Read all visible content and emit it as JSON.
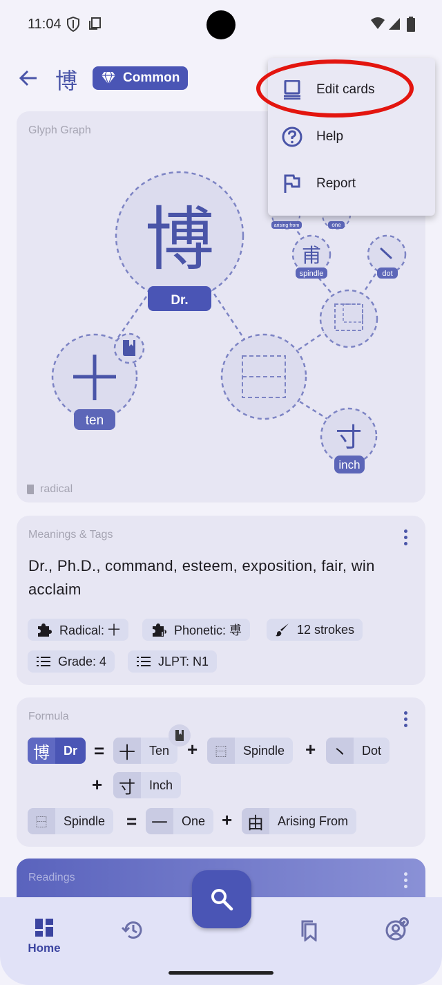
{
  "status_bar": {
    "time": "11:04"
  },
  "app_bar": {
    "title": "博",
    "badge_label": "Common"
  },
  "glyph_graph": {
    "title": "Glyph Graph",
    "main_kanji": "博",
    "main_label": "Dr.",
    "nodes": {
      "ten": {
        "glyph": "十",
        "label": "ten"
      },
      "inch": {
        "glyph": "寸",
        "label": "inch"
      },
      "spindle": {
        "glyph": "甫",
        "label": "spindle"
      },
      "dot": {
        "glyph": "丶",
        "label": "dot"
      },
      "arising_from": {
        "label": "arising from"
      },
      "one": {
        "label": "one"
      }
    },
    "legend_label": "radical"
  },
  "meanings": {
    "title": "Meanings & Tags",
    "text": "Dr., Ph.D., command, esteem, exposition, fair, win acclaim",
    "tags": {
      "radical": "Radical: 十",
      "phonetic": "Phonetic: 尃",
      "strokes": "12 strokes",
      "grade": "Grade: 4",
      "jlpt": "JLPT: N1"
    }
  },
  "formula": {
    "title": "Formula",
    "row1": {
      "main_glyph": "博",
      "main_label": "Dr",
      "eq": "=",
      "ten_glyph": "十",
      "ten_label": "Ten",
      "plus": "+",
      "spindle_glyph": "⿱",
      "spindle_label": "Spindle",
      "dot_glyph": "丶",
      "dot_label": "Dot",
      "inch_glyph": "寸",
      "inch_label": "Inch"
    },
    "row2": {
      "spindle_glyph": "⿱",
      "spindle_label": "Spindle",
      "eq": "=",
      "one_glyph": "—",
      "one_label": "One",
      "plus": "+",
      "arising_glyph": "由",
      "arising_label": "Arising From"
    }
  },
  "readings": {
    "title": "Readings"
  },
  "bottom_nav": {
    "home_label": "Home"
  },
  "menu": {
    "items": [
      {
        "label": "Edit cards"
      },
      {
        "label": "Help"
      },
      {
        "label": "Report"
      }
    ]
  },
  "colors": {
    "accent": "#4a55b5",
    "highlight": "#e3150f",
    "card": "#e7e6f3"
  }
}
